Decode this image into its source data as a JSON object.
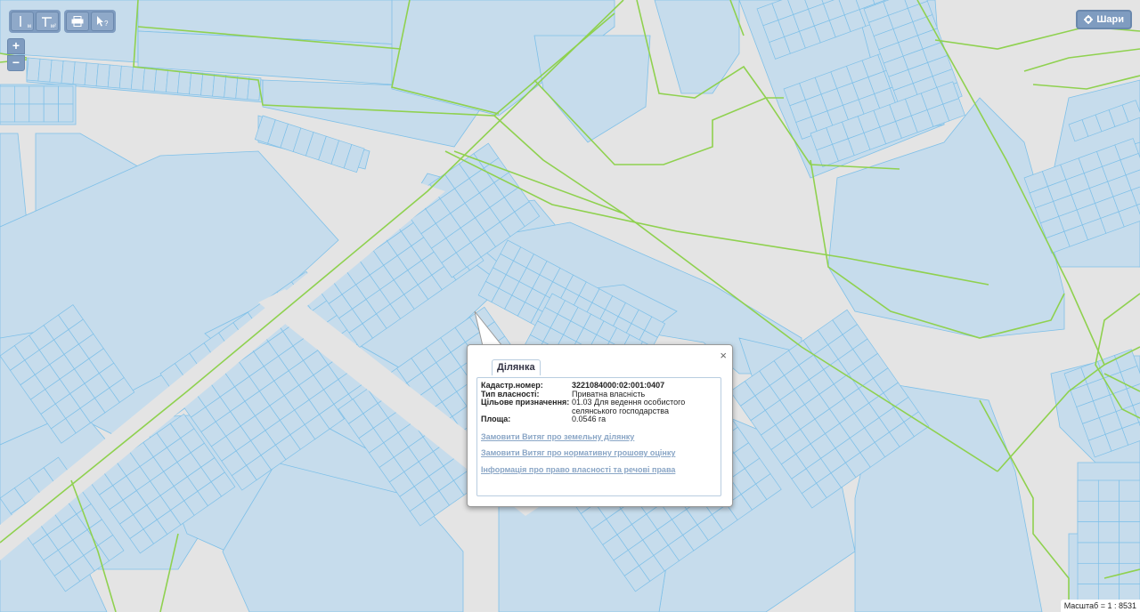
{
  "toolbar": {
    "measure_line_sub": "м",
    "measure_area_sub": "м²",
    "print_icon": "printer-icon",
    "info_icon": "pointer-query-icon"
  },
  "zoom": {
    "in_label": "+",
    "out_label": "−"
  },
  "layers_button": {
    "label": "Шари",
    "icon": "gear-icon"
  },
  "popup": {
    "tab_label": "Ділянка",
    "close_label": "×",
    "fields": [
      {
        "label": "Кадастр.номер:",
        "value": "3221084000:02:001:0407",
        "bold": true
      },
      {
        "label": "Тип власності:",
        "value": "Приватна власність"
      },
      {
        "label": "Цільове призначення:",
        "value": "01.03 Для ведення особистого селянського господарства"
      },
      {
        "label": "Площа:",
        "value": "0.0546 га"
      }
    ],
    "links": [
      "Замовити Витяг про земельну ділянку",
      "Замовити Витяг про нормативну грошову оцінку",
      "Інформація про право власності та речові права"
    ]
  },
  "scale": {
    "label": "Масштаб = 1 : 8531"
  },
  "colors": {
    "parcel_fill": "#c6dcec",
    "parcel_line": "#7fc0e8",
    "boundary": "#8fd14f",
    "background": "#e4e4e4"
  }
}
